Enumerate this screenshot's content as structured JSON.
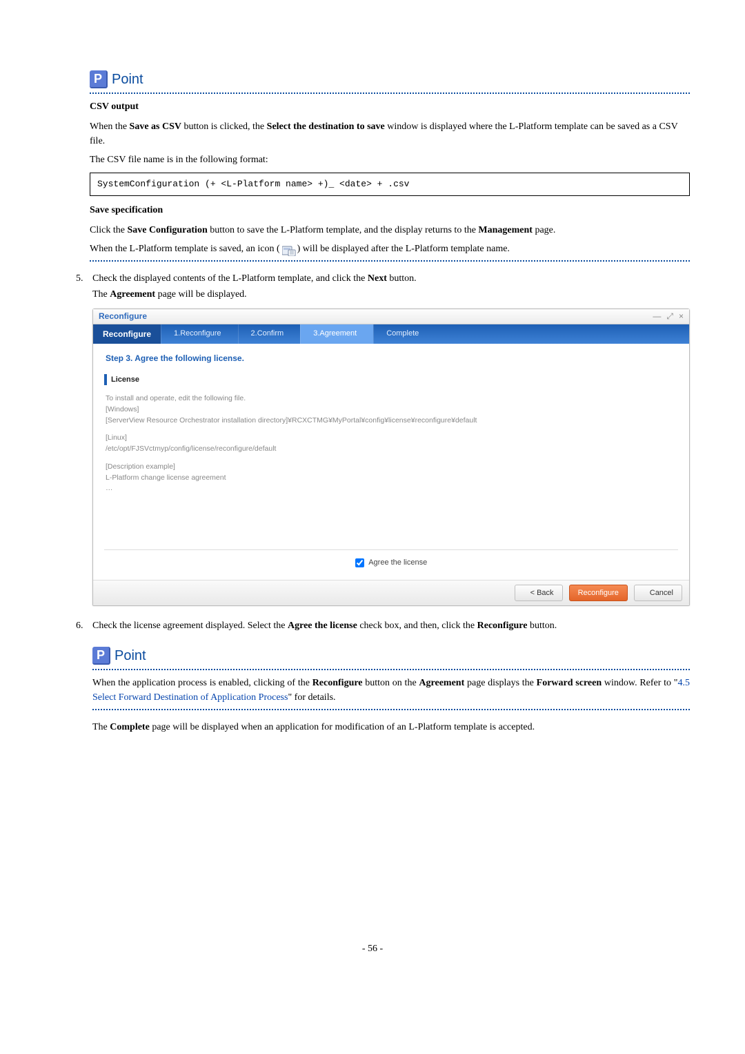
{
  "point1": {
    "label": "Point",
    "csv_heading": "CSV output",
    "csv_para1_pre": "When the ",
    "csv_para1_b1": "Save as CSV",
    "csv_para1_mid": " button is clicked, the ",
    "csv_para1_b2": "Select the destination to save",
    "csv_para1_post": " window is displayed where the L-Platform template can be saved as a CSV file.",
    "csv_para2": "The CSV file name is in the following format:",
    "csv_code": "SystemConfiguration (+ <L-Platform name> +)_ <date> + .csv",
    "save_heading": "Save specification",
    "save_para1_pre": "Click the ",
    "save_para1_b1": "Save Configuration",
    "save_para1_mid": " button to save the L-Platform template, and the display returns to the ",
    "save_para1_b2": "Management",
    "save_para1_post": " page.",
    "save_para2_pre": "When the L-Platform template is saved, an icon ( ",
    "save_para2_post": " ) will be displayed after the L-Platform template name."
  },
  "step5": {
    "line1_pre": "Check the displayed contents of the L-Platform template, and click the ",
    "line1_b": "Next",
    "line1_post": " button.",
    "line2_pre": "The ",
    "line2_b": "Agreement",
    "line2_post": " page will be displayed."
  },
  "mock": {
    "titlebar_title": "Reconfigure",
    "tabs": {
      "title": "Reconfigure",
      "t1": "1.Reconfigure",
      "t2": "2.Confirm",
      "t3": "3.Agreement",
      "t4": "Complete"
    },
    "step_label": "Step 3. Agree the following license.",
    "panel_title": "License",
    "lic_line1": "To install and operate, edit the following file.",
    "lic_win_label": "[Windows]",
    "lic_win_path": "[ServerView Resource Orchestrator installation directory]¥RCXCTMG¥MyPortal¥config¥license¥reconfigure¥default",
    "lic_linux_label": "[Linux]",
    "lic_linux_path": "/etc/opt/FJSVctmyp/config/license/reconfigure/default",
    "lic_desc_label": "[Description example]",
    "lic_desc_text": "L-Platform change license agreement",
    "lic_ellipsis": "…",
    "agree_label": "Agree the license",
    "buttons": {
      "back": "< Back",
      "reconfigure": "Reconfigure",
      "cancel": "Cancel"
    },
    "window_controls": {
      "min": "—",
      "max": "⤢",
      "close": "×"
    }
  },
  "step6": {
    "pre": "Check the license agreement displayed. Select the ",
    "b1": "Agree the license",
    "mid": " check box, and then, click the ",
    "b2": "Reconfigure",
    "post": " button."
  },
  "point2": {
    "label": "Point",
    "para_pre": "When the application process is enabled, clicking of the ",
    "para_b1": "Reconfigure",
    "para_mid1": " button on the ",
    "para_b2": "Agreement",
    "para_mid2": " page displays the ",
    "para_b3": "Forward screen",
    "para_mid3": " window. Refer to \"",
    "link_text": "4.5 Select Forward Destination of Application Process",
    "para_post": "\" for details."
  },
  "final_para": {
    "pre": "The ",
    "b": "Complete",
    "post": " page will be displayed when an application for modification of an L-Platform template is accepted."
  },
  "page_number": "- 56 -"
}
